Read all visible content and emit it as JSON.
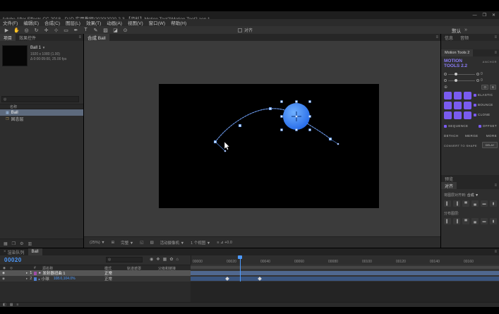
{
  "titlebar": {
    "title": "Adobe After Effects CC 2018 - D:\\D 实用教程\\2020\\2020-2-3 【资料】Motion Tool2\\Motion Tool2.aep *",
    "minimize": "—",
    "maximize": "❐",
    "close": "✕"
  },
  "menubar": {
    "items": [
      "文件(F)",
      "编辑(E)",
      "合成(C)",
      "图层(L)",
      "效果(T)",
      "动画(A)",
      "视图(V)",
      "窗口(W)",
      "帮助(H)"
    ]
  },
  "toolbar": {
    "tools": [
      {
        "name": "selection",
        "glyph": "▶"
      },
      {
        "name": "hand",
        "glyph": "✋"
      },
      {
        "name": "zoom",
        "glyph": "◎"
      },
      {
        "name": "rotation",
        "glyph": "↻"
      },
      {
        "name": "camera",
        "glyph": "✛"
      },
      {
        "name": "pan-behind",
        "glyph": "⊹"
      },
      {
        "name": "shape",
        "glyph": "▭"
      },
      {
        "name": "pen",
        "glyph": "✒"
      },
      {
        "name": "type",
        "glyph": "T"
      },
      {
        "name": "brush",
        "glyph": "✎"
      },
      {
        "name": "clone-stamp",
        "glyph": "▨"
      },
      {
        "name": "eraser",
        "glyph": "◪"
      },
      {
        "name": "puppet",
        "glyph": "⊙"
      }
    ],
    "snap_label": "对齐",
    "workspace": "默认",
    "overflow": "»"
  },
  "project": {
    "tabs": [
      "项目",
      "效果控件"
    ],
    "menu_icon": "≡",
    "item": {
      "name": "Ball 1",
      "caret": "▼",
      "dimensions": "1920 x 1080 (1.00)",
      "duration": "Δ 0:00:05:00, 25.00 fps"
    },
    "search_icon": "◎",
    "name_column": "名称",
    "rows": [
      {
        "icon": "▦",
        "name": "Ball"
      },
      {
        "icon": "❐",
        "name": "固态层"
      }
    ],
    "footer_icons": [
      "▦",
      "❐",
      "⚙",
      "▥"
    ]
  },
  "viewer": {
    "tab": "合成 Ball",
    "menu_icon": "≡",
    "statusbar": {
      "zoom": "(25%) ▼",
      "grid": "⊞",
      "resolution": "完整 ▼",
      "roi": "◱",
      "alpha": "▨",
      "camera": "活动摄像机 ▼",
      "views": "1 个视图 ▼",
      "extras": "≡ ⊿ +0.0"
    }
  },
  "info_panel": {
    "tabs": [
      "信息",
      "音频"
    ],
    "menu_icon": "≡"
  },
  "motion_tools": {
    "tab": "Motion Tools 2",
    "menu_icon": "≡",
    "brand1": "MOTION",
    "brand2": "TOOLS 2.2",
    "anchor_label": "ANCHOR",
    "slider_values": [
      "0",
      "0"
    ],
    "target_icon": "⊕",
    "mini_buttons": [
      "O",
      "B"
    ],
    "preset_labels": [
      "ELASTIC",
      "BOUNCE",
      "CLONE"
    ],
    "sequence_label": "SEQUENCE",
    "offset_label": "OFFSET",
    "action_labels": [
      "DETACH",
      "MERGE",
      "MORE"
    ],
    "convert_label": "CONVERT TO SHAPE",
    "delay_label": "DELAY"
  },
  "align_panel": {
    "preview_tab": "预览",
    "tab": "对齐",
    "menu_icon": "≡",
    "align_to_label": "将图层对齐到:",
    "align_to_value": "合成 ▼",
    "align_icons": [
      "▌",
      "▐",
      "▀",
      "▄",
      "▬",
      "▮"
    ],
    "distribute_label": "分布图层:",
    "distribute_icons": [
      "▌",
      "▐",
      "▀",
      "▄",
      "▬",
      "▮"
    ]
  },
  "timeline": {
    "tabs": [
      "渲染队列",
      "Ball"
    ],
    "close_icon": "×",
    "menu_icon": "≡",
    "frame": "00020",
    "search_icon": "◎",
    "icons": [
      "◉",
      "❖",
      "▦",
      "✿",
      "⌂"
    ],
    "header_icons": [
      "◉",
      "◎"
    ],
    "columns": {
      "num": "#",
      "source": "源名称",
      "mode": "模式",
      "trkmat": "轨道遮罩",
      "parent": "父级和链接"
    },
    "ruler": [
      "00000",
      "00020",
      "00040",
      "00060",
      "00080",
      "00100",
      "00120",
      "00140",
      "00160"
    ],
    "layers": [
      {
        "eye": "◉",
        "expand": "▸",
        "num": "1",
        "icon": "★",
        "name": "发射器扭曲 1",
        "mode": "正常"
      },
      {
        "eye": "◉",
        "expand": "▸",
        "num": "2",
        "icon": "●",
        "name": "小球",
        "mode": "正常",
        "value": "108.0,104.0%"
      }
    ],
    "bottom_icons": [
      "◧",
      "▦",
      "≡"
    ]
  }
}
